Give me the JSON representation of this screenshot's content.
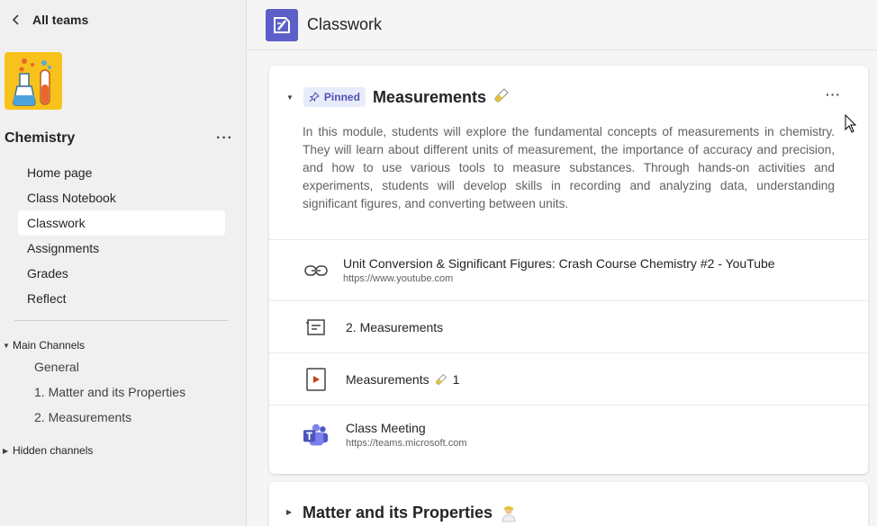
{
  "sidebar": {
    "back_label": "All teams",
    "team_name": "Chemistry",
    "more_label": "···",
    "nav": [
      {
        "label": "Home page",
        "active": false
      },
      {
        "label": "Class Notebook",
        "active": false
      },
      {
        "label": "Classwork",
        "active": true
      },
      {
        "label": "Assignments",
        "active": false
      },
      {
        "label": "Grades",
        "active": false
      },
      {
        "label": "Reflect",
        "active": false
      }
    ],
    "main_channels_label": "Main Channels",
    "channels": [
      "General",
      "1. Matter and its Properties",
      "2. Measurements"
    ],
    "hidden_channels_label": "Hidden channels"
  },
  "header": {
    "title": "Classwork"
  },
  "module": {
    "pinned_label": "Pinned",
    "title": "Measurements",
    "more_label": "···",
    "description": "In this module, students will explore the fundamental concepts of measurements in chemistry. They will learn about different units of measurement, the importance of accuracy and precision, and how to use various tools to measure substances. Through hands-on activities and experiments, students will develop skills in recording and analyzing data, understanding significant figures, and converting between units.",
    "resources": [
      {
        "icon": "link-icon",
        "title": "Unit Conversion & Significant Figures: Crash Course Chemistry #2 - YouTube",
        "subtitle": "https://www.youtube.com"
      },
      {
        "icon": "assignment-icon",
        "title": "2. Measurements",
        "subtitle": ""
      },
      {
        "icon": "video-icon",
        "title": "Measurements",
        "title_suffix": "1",
        "subtitle": ""
      },
      {
        "icon": "teams-icon",
        "title": "Class Meeting",
        "subtitle": "https://teams.microsoft.com"
      }
    ]
  },
  "module2": {
    "title": "Matter and its Properties"
  },
  "colors": {
    "accent": "#5b5fc7",
    "pinned_bg": "#e8ebfa",
    "team_logo_bg": "#f7c21b"
  }
}
